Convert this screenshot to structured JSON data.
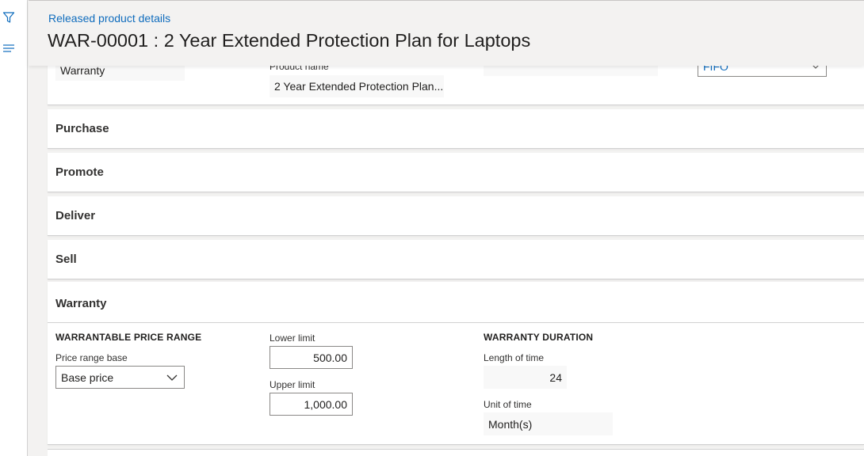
{
  "header": {
    "breadcrumb": "Released product details",
    "title": "WAR-00001 : 2 Year Extended Protection Plan for Laptops"
  },
  "general": {
    "product_type_value": "Warranty",
    "product_name_label": "Product name",
    "product_name_value": "2 Year Extended Protection Plan...",
    "model_group_value": "FIFO"
  },
  "sections": {
    "purchase": "Purchase",
    "promote": "Promote",
    "deliver": "Deliver",
    "sell": "Sell",
    "warranty": "Warranty"
  },
  "warranty": {
    "price_range_group": "WARRANTABLE PRICE RANGE",
    "price_range_base_label": "Price range base",
    "price_range_base_value": "Base price",
    "lower_limit_label": "Lower limit",
    "lower_limit_value": "500.00",
    "upper_limit_label": "Upper limit",
    "upper_limit_value": "1,000.00",
    "duration_group": "WARRANTY DURATION",
    "length_label": "Length of time",
    "length_value": "24",
    "unit_label": "Unit of time",
    "unit_value": "Month(s)"
  },
  "icons": {
    "filter": "filter-icon",
    "menu": "menu-lines-icon",
    "chevron": "chevron-down-icon"
  },
  "colors": {
    "link": "#0f6cbd",
    "accent": "#0078d4"
  }
}
